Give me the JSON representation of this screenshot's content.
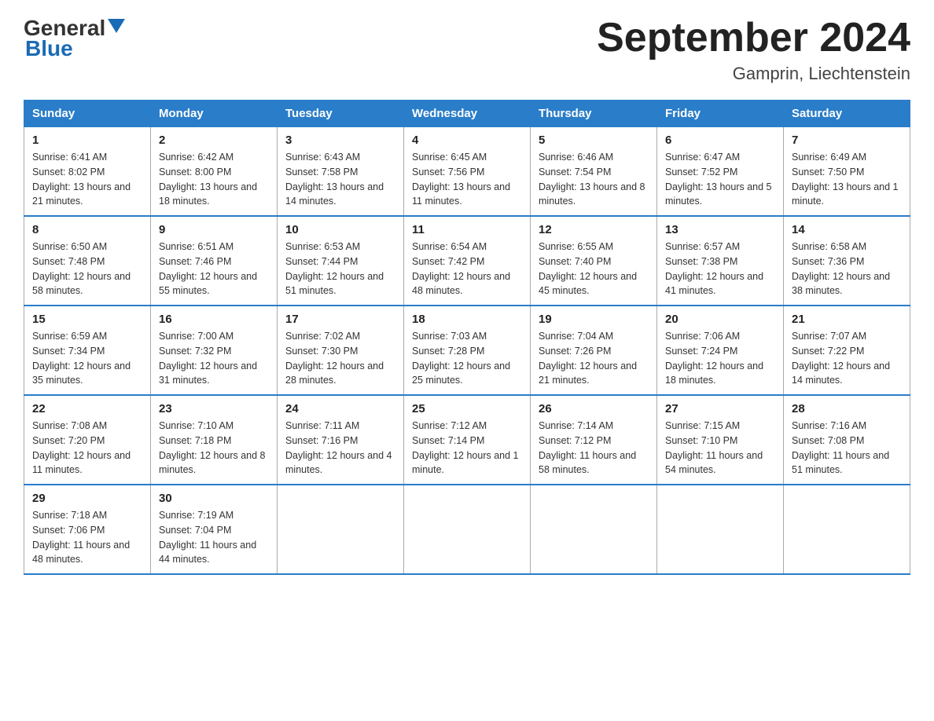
{
  "header": {
    "logo_general": "General",
    "logo_blue": "Blue",
    "title": "September 2024",
    "location": "Gamprin, Liechtenstein"
  },
  "weekdays": [
    "Sunday",
    "Monday",
    "Tuesday",
    "Wednesday",
    "Thursday",
    "Friday",
    "Saturday"
  ],
  "weeks": [
    [
      {
        "day": "1",
        "sunrise": "6:41 AM",
        "sunset": "8:02 PM",
        "daylight": "13 hours and 21 minutes."
      },
      {
        "day": "2",
        "sunrise": "6:42 AM",
        "sunset": "8:00 PM",
        "daylight": "13 hours and 18 minutes."
      },
      {
        "day": "3",
        "sunrise": "6:43 AM",
        "sunset": "7:58 PM",
        "daylight": "13 hours and 14 minutes."
      },
      {
        "day": "4",
        "sunrise": "6:45 AM",
        "sunset": "7:56 PM",
        "daylight": "13 hours and 11 minutes."
      },
      {
        "day": "5",
        "sunrise": "6:46 AM",
        "sunset": "7:54 PM",
        "daylight": "13 hours and 8 minutes."
      },
      {
        "day": "6",
        "sunrise": "6:47 AM",
        "sunset": "7:52 PM",
        "daylight": "13 hours and 5 minutes."
      },
      {
        "day": "7",
        "sunrise": "6:49 AM",
        "sunset": "7:50 PM",
        "daylight": "13 hours and 1 minute."
      }
    ],
    [
      {
        "day": "8",
        "sunrise": "6:50 AM",
        "sunset": "7:48 PM",
        "daylight": "12 hours and 58 minutes."
      },
      {
        "day": "9",
        "sunrise": "6:51 AM",
        "sunset": "7:46 PM",
        "daylight": "12 hours and 55 minutes."
      },
      {
        "day": "10",
        "sunrise": "6:53 AM",
        "sunset": "7:44 PM",
        "daylight": "12 hours and 51 minutes."
      },
      {
        "day": "11",
        "sunrise": "6:54 AM",
        "sunset": "7:42 PM",
        "daylight": "12 hours and 48 minutes."
      },
      {
        "day": "12",
        "sunrise": "6:55 AM",
        "sunset": "7:40 PM",
        "daylight": "12 hours and 45 minutes."
      },
      {
        "day": "13",
        "sunrise": "6:57 AM",
        "sunset": "7:38 PM",
        "daylight": "12 hours and 41 minutes."
      },
      {
        "day": "14",
        "sunrise": "6:58 AM",
        "sunset": "7:36 PM",
        "daylight": "12 hours and 38 minutes."
      }
    ],
    [
      {
        "day": "15",
        "sunrise": "6:59 AM",
        "sunset": "7:34 PM",
        "daylight": "12 hours and 35 minutes."
      },
      {
        "day": "16",
        "sunrise": "7:00 AM",
        "sunset": "7:32 PM",
        "daylight": "12 hours and 31 minutes."
      },
      {
        "day": "17",
        "sunrise": "7:02 AM",
        "sunset": "7:30 PM",
        "daylight": "12 hours and 28 minutes."
      },
      {
        "day": "18",
        "sunrise": "7:03 AM",
        "sunset": "7:28 PM",
        "daylight": "12 hours and 25 minutes."
      },
      {
        "day": "19",
        "sunrise": "7:04 AM",
        "sunset": "7:26 PM",
        "daylight": "12 hours and 21 minutes."
      },
      {
        "day": "20",
        "sunrise": "7:06 AM",
        "sunset": "7:24 PM",
        "daylight": "12 hours and 18 minutes."
      },
      {
        "day": "21",
        "sunrise": "7:07 AM",
        "sunset": "7:22 PM",
        "daylight": "12 hours and 14 minutes."
      }
    ],
    [
      {
        "day": "22",
        "sunrise": "7:08 AM",
        "sunset": "7:20 PM",
        "daylight": "12 hours and 11 minutes."
      },
      {
        "day": "23",
        "sunrise": "7:10 AM",
        "sunset": "7:18 PM",
        "daylight": "12 hours and 8 minutes."
      },
      {
        "day": "24",
        "sunrise": "7:11 AM",
        "sunset": "7:16 PM",
        "daylight": "12 hours and 4 minutes."
      },
      {
        "day": "25",
        "sunrise": "7:12 AM",
        "sunset": "7:14 PM",
        "daylight": "12 hours and 1 minute."
      },
      {
        "day": "26",
        "sunrise": "7:14 AM",
        "sunset": "7:12 PM",
        "daylight": "11 hours and 58 minutes."
      },
      {
        "day": "27",
        "sunrise": "7:15 AM",
        "sunset": "7:10 PM",
        "daylight": "11 hours and 54 minutes."
      },
      {
        "day": "28",
        "sunrise": "7:16 AM",
        "sunset": "7:08 PM",
        "daylight": "11 hours and 51 minutes."
      }
    ],
    [
      {
        "day": "29",
        "sunrise": "7:18 AM",
        "sunset": "7:06 PM",
        "daylight": "11 hours and 48 minutes."
      },
      {
        "day": "30",
        "sunrise": "7:19 AM",
        "sunset": "7:04 PM",
        "daylight": "11 hours and 44 minutes."
      },
      null,
      null,
      null,
      null,
      null
    ]
  ],
  "labels": {
    "sunrise": "Sunrise:",
    "sunset": "Sunset:",
    "daylight": "Daylight:"
  }
}
